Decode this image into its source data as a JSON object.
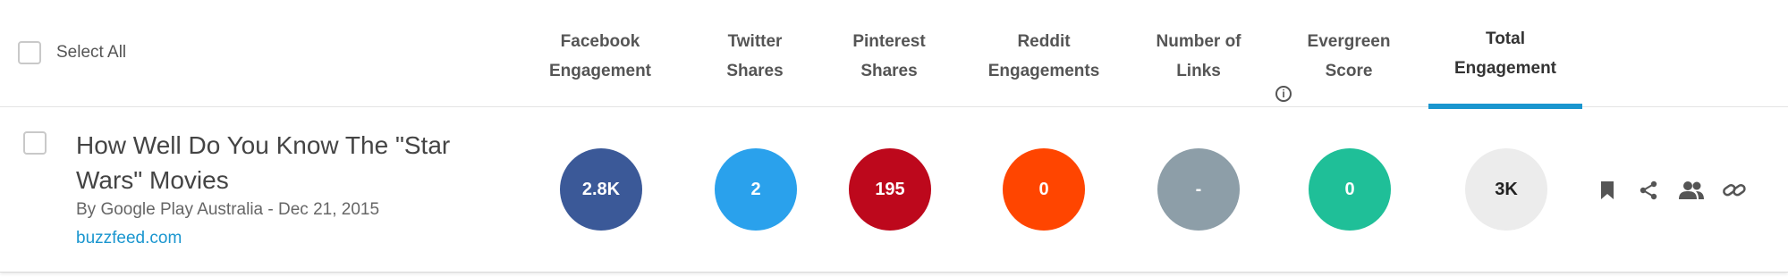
{
  "select_all": {
    "label": "Select All",
    "checked": false
  },
  "columns": [
    {
      "line1": "Facebook",
      "line2": "Engagement"
    },
    {
      "line1": "Twitter",
      "line2": "Shares"
    },
    {
      "line1": "Pinterest",
      "line2": "Shares"
    },
    {
      "line1": "Reddit",
      "line2": "Engagements"
    },
    {
      "line1": "Number of",
      "line2": "Links"
    },
    {
      "line1": "Evergreen",
      "line2": "Score",
      "info_icon": "info-circle-icon"
    },
    {
      "line1": "Total",
      "line2": "Engagement",
      "active": true
    }
  ],
  "article": {
    "title": "How Well Do You Know The \"Star Wars\" Movies",
    "byline": "By Google Play Australia - Dec 21, 2015",
    "domain": "buzzfeed.com",
    "metrics": [
      {
        "value": "2.8K",
        "color": "#3b5998"
      },
      {
        "value": "2",
        "color": "#2aa1ec"
      },
      {
        "value": "195",
        "color": "#bd081c"
      },
      {
        "value": "0",
        "color": "#ff4500"
      },
      {
        "value": "-",
        "color": "#8d9ea8"
      },
      {
        "value": "0",
        "color": "#1fbf98"
      },
      {
        "value": "3K",
        "color": "#ececec"
      }
    ],
    "actions": [
      "bookmark-icon",
      "share-icon",
      "users-icon",
      "link-icon"
    ]
  },
  "colors": {
    "accent": "#1a96cf"
  }
}
